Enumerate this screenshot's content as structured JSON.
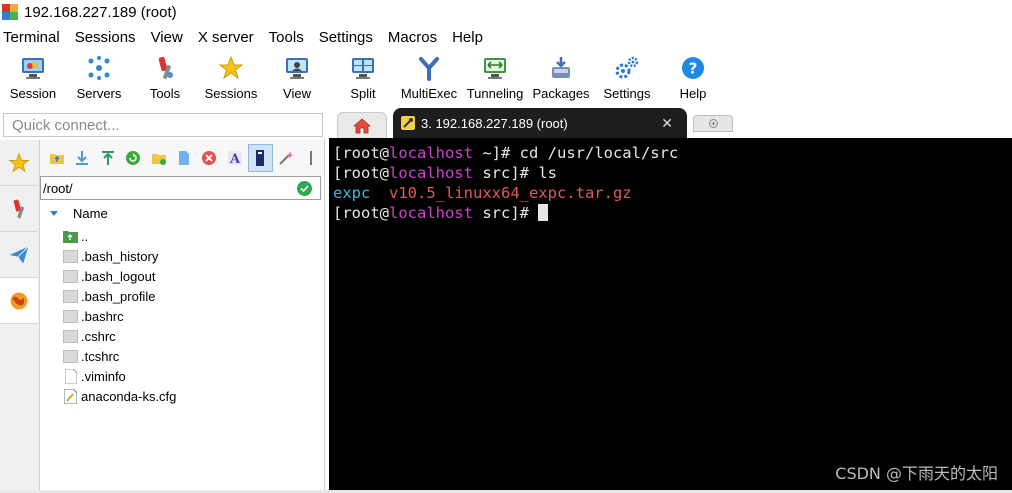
{
  "window": {
    "title": "192.168.227.189 (root)"
  },
  "menu": [
    "Terminal",
    "Sessions",
    "View",
    "X server",
    "Tools",
    "Settings",
    "Macros",
    "Help"
  ],
  "toolbar": [
    {
      "label": "Session",
      "icon": "session-icon"
    },
    {
      "label": "Servers",
      "icon": "servers-icon"
    },
    {
      "label": "Tools",
      "icon": "tools-icon"
    },
    {
      "label": "Sessions",
      "icon": "sessions-star-icon"
    },
    {
      "label": "View",
      "icon": "view-icon"
    },
    {
      "label": "Split",
      "icon": "split-icon"
    },
    {
      "label": "MultiExec",
      "icon": "multiexec-icon"
    },
    {
      "label": "Tunneling",
      "icon": "tunneling-icon"
    },
    {
      "label": "Packages",
      "icon": "packages-icon"
    },
    {
      "label": "Settings",
      "icon": "settings-gears-icon"
    },
    {
      "label": "Help",
      "icon": "help-icon"
    }
  ],
  "quick_connect": {
    "placeholder": "Quick connect..."
  },
  "tabs": {
    "active_label": "3. 192.168.227.189 (root)",
    "close_glyph": "✕"
  },
  "file_browser": {
    "path": "/root/",
    "column_header": "Name",
    "items": [
      {
        "name": "..",
        "type": "parent"
      },
      {
        "name": ".bash_history",
        "type": "file"
      },
      {
        "name": ".bash_logout",
        "type": "file"
      },
      {
        "name": ".bash_profile",
        "type": "file"
      },
      {
        "name": ".bashrc",
        "type": "file"
      },
      {
        "name": ".cshrc",
        "type": "file"
      },
      {
        "name": ".tcshrc",
        "type": "file"
      },
      {
        "name": ".viminfo",
        "type": "doc"
      },
      {
        "name": "anaconda-ks.cfg",
        "type": "cfg"
      }
    ]
  },
  "terminal": {
    "lines": [
      {
        "pre": "[root@",
        "host": "localhost",
        "post": " ~]# cd /usr/local/src"
      },
      {
        "pre": "[root@",
        "host": "localhost",
        "post": " src]# ls"
      },
      {
        "dir": "expc",
        "gap": "  ",
        "archive": "v10.5_linuxx64_expc.tar.gz"
      },
      {
        "pre": "[root@",
        "host": "localhost",
        "post": " src]# "
      }
    ],
    "colors": {
      "host": "#d040d0",
      "dir": "#3fb6e0",
      "archive": "#e05a5a"
    }
  },
  "watermark": "CSDN @下雨天的太阳"
}
